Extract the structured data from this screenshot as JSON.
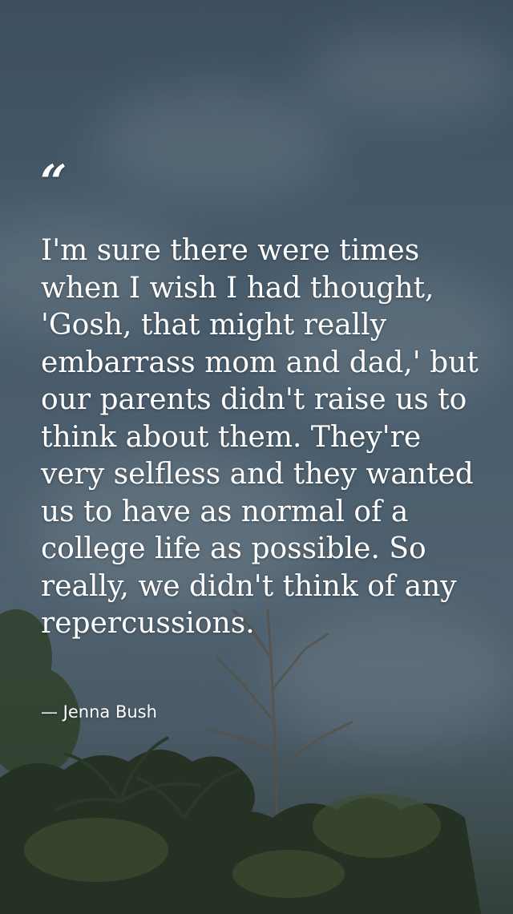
{
  "quote": {
    "mark": "“",
    "text": "I'm sure there were times when I wish I had thought, 'Gosh, that might really embarrass mom and dad,' but our parents didn't raise us to think about them. They're very selfless and they wanted us to have as normal of a college life as possible. So really, we didn't think of any repercussions.",
    "author": "— Jenna Bush"
  }
}
